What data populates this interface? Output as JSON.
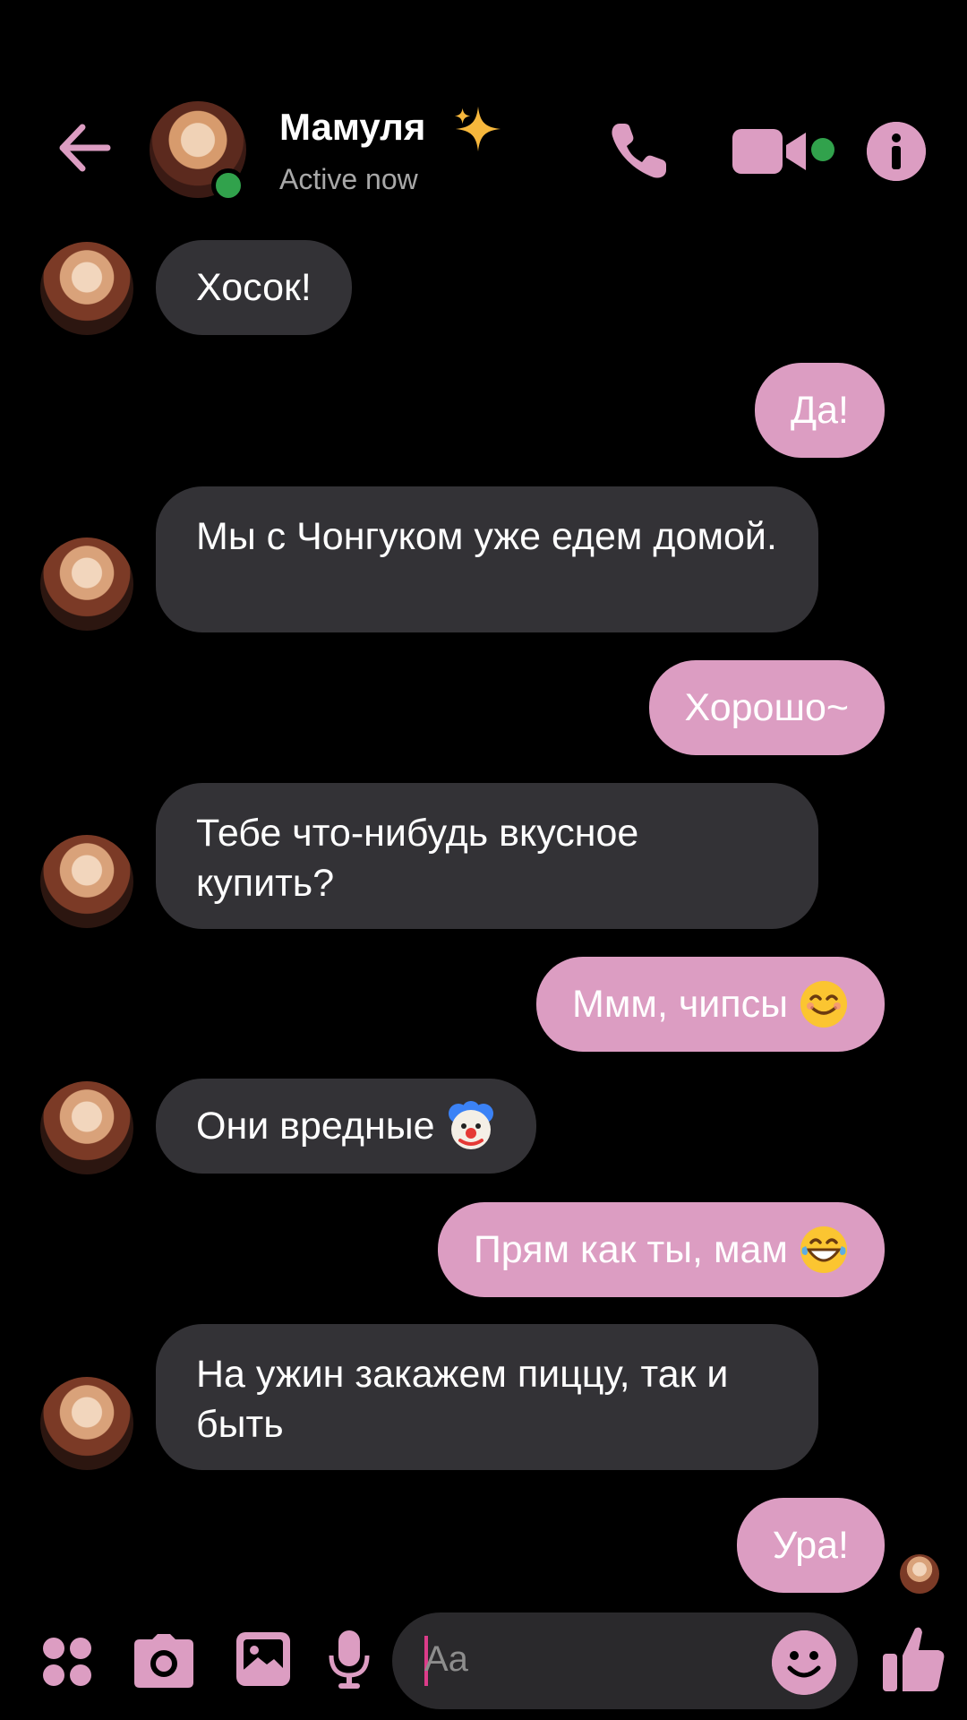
{
  "header": {
    "contact_name": "Мамуля",
    "status": "Active now",
    "back_icon": "arrow-left-icon",
    "call_icon": "phone-icon",
    "video_icon": "video-camera-icon",
    "info_icon": "info-icon"
  },
  "messages": [
    {
      "side": "in",
      "text": "Хосок!"
    },
    {
      "side": "out",
      "text": "Да!"
    },
    {
      "side": "in",
      "text": "Мы с Чонгуком уже едем домой."
    },
    {
      "side": "out",
      "text": "Хорошо~"
    },
    {
      "side": "in",
      "text": "Тебе что-нибудь вкусное купить?"
    },
    {
      "side": "out",
      "text": "Ммм, чипсы",
      "emoji": "smiling-face-icon"
    },
    {
      "side": "in",
      "text": "Они вредные",
      "emoji": "clown-face-icon"
    },
    {
      "side": "out",
      "text": "Прям как ты, мам",
      "emoji": "grinning-sweat-face-icon"
    },
    {
      "side": "in",
      "text": "На ужин закажем пиццу, так и быть"
    },
    {
      "side": "out",
      "text": "Ура!"
    }
  ],
  "composer": {
    "placeholder": "Aa",
    "icons": [
      "apps-icon",
      "camera-icon",
      "gallery-icon",
      "microphone-icon",
      "emoji-icon",
      "thumbs-up-icon"
    ]
  },
  "colors": {
    "accent": "#dc9dc2",
    "incoming_bubble": "#333236",
    "background": "#000000",
    "online": "#31a24c"
  }
}
